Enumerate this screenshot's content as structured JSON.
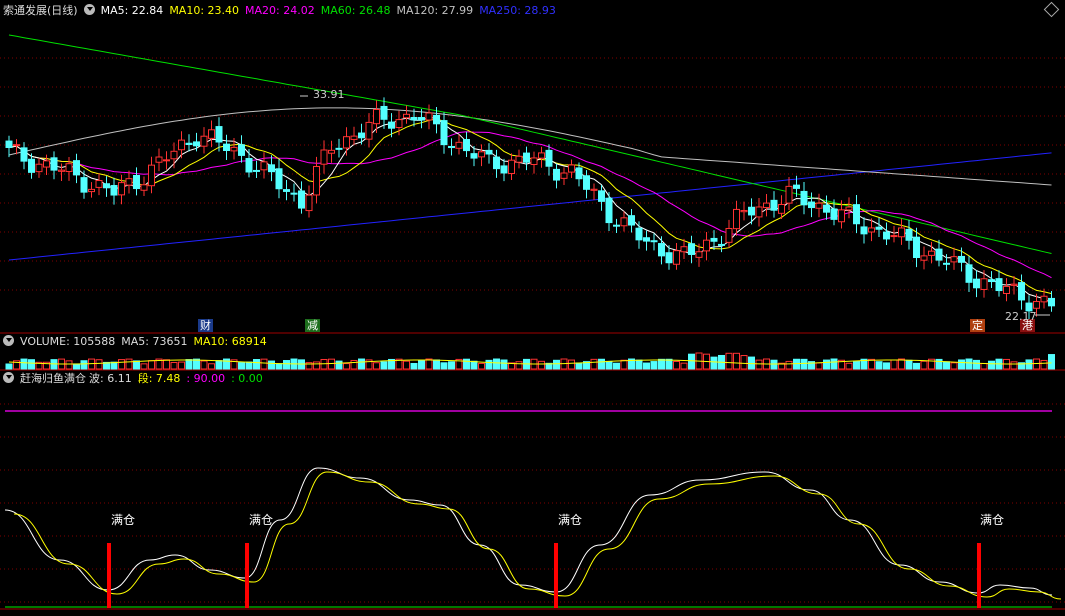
{
  "header": {
    "stock": "索通发展(日线)",
    "ma5": "MA5: 22.84",
    "ma10": "MA10: 23.40",
    "ma20": "MA20: 24.02",
    "ma60": "MA60: 26.48",
    "ma120": "MA120: 27.99",
    "ma250": "MA250: 28.93"
  },
  "volume_header": {
    "vol": "VOLUME: 105588",
    "ma5": "MA5: 73651",
    "ma10": "MA10: 68914"
  },
  "indicator_header": {
    "name": "赶海归鱼满仓",
    "wave": "波: 6.11",
    "seg": "段: 7.48",
    "v3": ": 90.00",
    "v4": ": 0.00"
  },
  "price_labels": {
    "high": "33.91",
    "last": "22.17"
  },
  "event_tags": [
    "财",
    "减",
    "定",
    "港"
  ],
  "signal_label": "满仓",
  "colors": {
    "up": "#ff3232",
    "down": "#54ffff",
    "ma5": "#ffffff",
    "ma10": "#ffff00",
    "ma20": "#ff00ff",
    "ma60": "#00e000",
    "ma120": "#c0c0c0",
    "ma250": "#2222ff",
    "grid": "#800000"
  },
  "chart_data": {
    "type": "candlestick",
    "title": "索通发展(日线)",
    "price_range": [
      21.5,
      35.5
    ],
    "moving_averages_latest": {
      "MA5": 22.84,
      "MA10": 23.4,
      "MA20": 24.02,
      "MA60": 26.48,
      "MA120": 27.99,
      "MA250": 28.93
    },
    "high_marker": 33.91,
    "last_marker": 22.17,
    "volume_latest": 105588,
    "volume_ma5": 73651,
    "volume_ma10": 68914,
    "indicator": {
      "name": "赶海归鱼满仓",
      "波": 6.11,
      "段": 7.48,
      "line3": 90.0,
      "line4": 0.0
    },
    "signals": [
      "满仓",
      "满仓",
      "满仓",
      "满仓"
    ]
  }
}
